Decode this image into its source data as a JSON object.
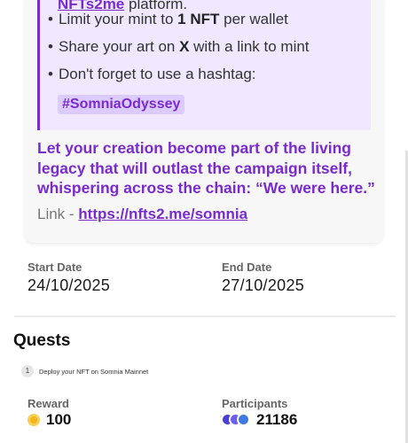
{
  "description": {
    "top_line": {
      "link_text": "NFTs2me",
      "rest": " platform."
    },
    "bullets": [
      {
        "before": "Limit your mint to ",
        "bold": "1 NFT",
        "after": " per wallet"
      },
      {
        "before": "Share your art on ",
        "bold": "X",
        "after": " with a link to mint"
      },
      {
        "before": "Don't forget to use a hashtag:",
        "bold": "",
        "after": ""
      }
    ],
    "hashtag": "#SomniaOdyssey",
    "closing_lines": [
      "Let your creation become part of the living",
      "legacy that will outlast the campaign itself,",
      "whispering across the chain: “We were here.”"
    ],
    "link_label": "Link - ",
    "link_url": "https://nfts2.me/somnia"
  },
  "dates": {
    "start_label": "Start Date",
    "start_value": "24/10/2025",
    "end_label": "End Date",
    "end_value": "27/10/2025"
  },
  "quests": {
    "title": "Quests",
    "steps": [
      {
        "number": "1",
        "text": "Deploy your NFT on Somnia Mainnet"
      }
    ]
  },
  "reward": {
    "label": "Reward",
    "value": "100",
    "icon": "coin-icon"
  },
  "participants": {
    "label": "Participants",
    "value": "21186",
    "avatar_colors": [
      "#4a3fd6",
      "#6c5cf0",
      "#3f78e0"
    ]
  },
  "colors": {
    "accent": "#7a2bd0",
    "quote_bg": "#efe8ff",
    "tag_bg": "#dccbff"
  }
}
